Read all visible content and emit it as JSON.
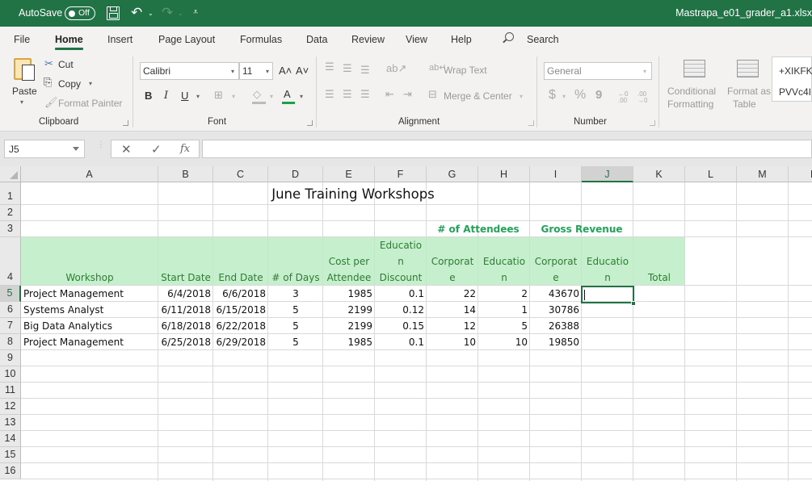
{
  "titlebar": {
    "autosave_label": "AutoSave",
    "autosave_state": "Off",
    "filename": "Mastrapa_e01_grader_a1.xlsx"
  },
  "tabs": [
    "File",
    "Home",
    "Insert",
    "Page Layout",
    "Formulas",
    "Data",
    "Review",
    "View",
    "Help"
  ],
  "active_tab": "Home",
  "search_label": "Search",
  "ribbon": {
    "clipboard": {
      "paste": "Paste",
      "cut": "Cut",
      "copy": "Copy",
      "format_painter": "Format Painter",
      "label": "Clipboard"
    },
    "font": {
      "name": "Calibri",
      "size": "11",
      "bold": "B",
      "italic": "I",
      "underline": "U",
      "label": "Font"
    },
    "alignment": {
      "wrap_text": "Wrap Text",
      "merge_center": "Merge & Center",
      "label": "Alignment"
    },
    "number": {
      "format": "General",
      "currency": "$",
      "percent": "%",
      "comma": "9",
      "label": "Number"
    },
    "styles": {
      "conditional_1": "Conditional",
      "conditional_2": "Formatting",
      "format_as_1": "Format as",
      "format_as_2": "Table",
      "style_1": "+XIKFK",
      "style_2": "PVVc4I"
    }
  },
  "formula_bar": {
    "name_box": "J5",
    "cancel": "✕",
    "enter": "✓",
    "fx": "fx",
    "content": ""
  },
  "columns": [
    "A",
    "B",
    "C",
    "D",
    "E",
    "F",
    "G",
    "H",
    "I",
    "J",
    "K",
    "L",
    "M",
    "N"
  ],
  "selected_column": "J",
  "rows": [
    "1",
    "2",
    "3",
    "4",
    "5",
    "6",
    "7",
    "8",
    "9",
    "10",
    "11",
    "12",
    "13",
    "14",
    "15",
    "16"
  ],
  "selected_row": "5",
  "sheet": {
    "title": "June Training Workshops",
    "group_headers": {
      "attendees": "# of Attendees",
      "gross_revenue": "Gross Revenue"
    },
    "headers": [
      [
        "Workshop"
      ],
      [
        "Start Date"
      ],
      [
        "End Date"
      ],
      [
        "# of Days"
      ],
      [
        "Cost per",
        "Attendee"
      ],
      [
        "Educatio",
        "n",
        "Discount"
      ],
      [
        "Corporat",
        "e"
      ],
      [
        "Educatio",
        "n"
      ],
      [
        "Corporat",
        "e"
      ],
      [
        "Educatio",
        "n"
      ],
      [
        "Total"
      ]
    ],
    "data": [
      [
        "Project Management",
        "6/4/2018",
        "6/6/2018",
        "3",
        "1985",
        "0.1",
        "22",
        "2",
        "43670"
      ],
      [
        "Systems Analyst",
        "6/11/2018",
        "6/15/2018",
        "5",
        "2199",
        "0.12",
        "14",
        "1",
        "30786"
      ],
      [
        "Big Data Analytics",
        "6/18/2018",
        "6/22/2018",
        "5",
        "2199",
        "0.15",
        "12",
        "5",
        "26388"
      ],
      [
        "Project Management",
        "6/25/2018",
        "6/29/2018",
        "5",
        "1985",
        "0.1",
        "10",
        "10",
        "19850"
      ]
    ],
    "active_cell": "J5"
  }
}
